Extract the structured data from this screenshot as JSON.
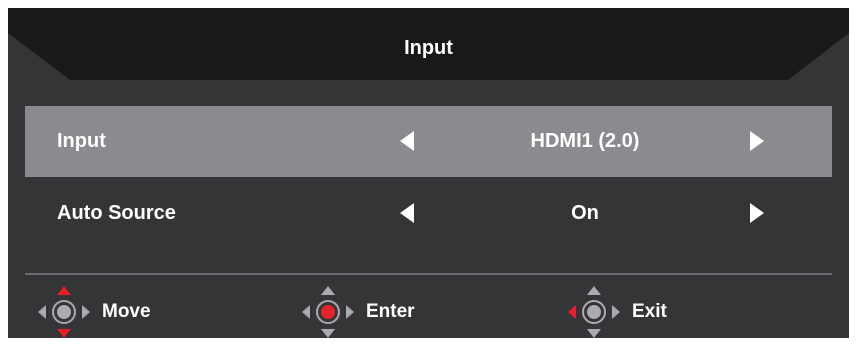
{
  "header": {
    "title": "Input"
  },
  "menu": {
    "items": [
      {
        "label": "Input",
        "value": "HDMI1 (2.0)",
        "selected": true,
        "left_arrow_icon": "triangle-left-icon",
        "right_arrow_icon": "triangle-right-icon"
      },
      {
        "label": "Auto Source",
        "value": "On",
        "selected": false,
        "left_arrow_icon": "triangle-left-icon",
        "right_arrow_icon": "triangle-right-icon"
      }
    ]
  },
  "footer": {
    "hints": [
      {
        "label": "Move",
        "icon": "joystick-move-icon",
        "highlight": "up-down"
      },
      {
        "label": "Enter",
        "icon": "joystick-enter-icon",
        "highlight": "center"
      },
      {
        "label": "Exit",
        "icon": "joystick-exit-icon",
        "highlight": "left"
      }
    ]
  },
  "colors": {
    "panel_background": "#333537",
    "title_background": "#19191b",
    "selected_row": "#898b8e",
    "divider": "#6a6c6f",
    "text": "#ffffff",
    "accent_red": "#e8202a",
    "icon_gray": "#a9abae"
  }
}
